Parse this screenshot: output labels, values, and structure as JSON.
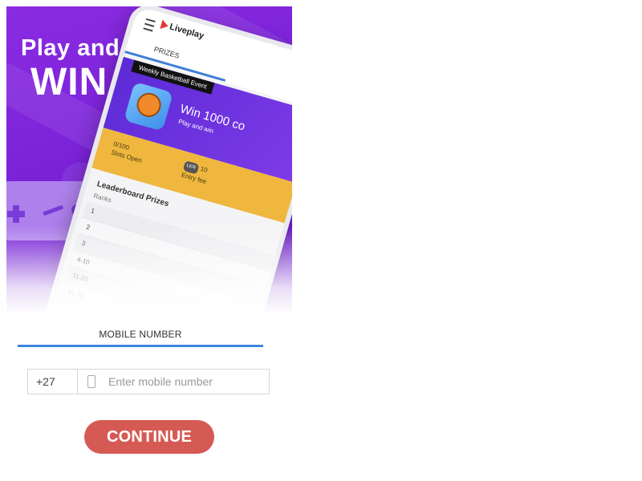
{
  "hero": {
    "line1": "Play and",
    "line2": "WIN"
  },
  "phone_mockup": {
    "brand": "Liveplay",
    "tab": "PRIZES",
    "event_badge": "Weekly Basketball Event",
    "win_text": "Win 1000 co",
    "sub_text": "Play and win",
    "slots_value": "0/100",
    "slots_label": "Slots Open",
    "fee_currency": "LKR",
    "fee_value": "10",
    "fee_label": "Entry fee",
    "leaderboard_title": "Leaderboard Prizes",
    "ranks_label": "Ranks",
    "ranks": [
      "1",
      "2",
      "3",
      "4-10",
      "11-20",
      "21-30"
    ]
  },
  "form": {
    "tab_label": "MOBILE NUMBER",
    "country_code": "+27",
    "mobile_placeholder": "Enter mobile number",
    "continue_label": "CONTINUE"
  },
  "colors": {
    "hero_purple": "#7a22d8",
    "tab_underline": "#3d86df",
    "continue_button": "#d65a54",
    "banner_yellow": "#efb73e"
  },
  "icons": {
    "menu": "hamburger-icon",
    "logo": "play-triangle-icon",
    "phone_field": "mobile-phone-icon",
    "controller": "gamepad-icon",
    "ball": "basketball-icon"
  }
}
